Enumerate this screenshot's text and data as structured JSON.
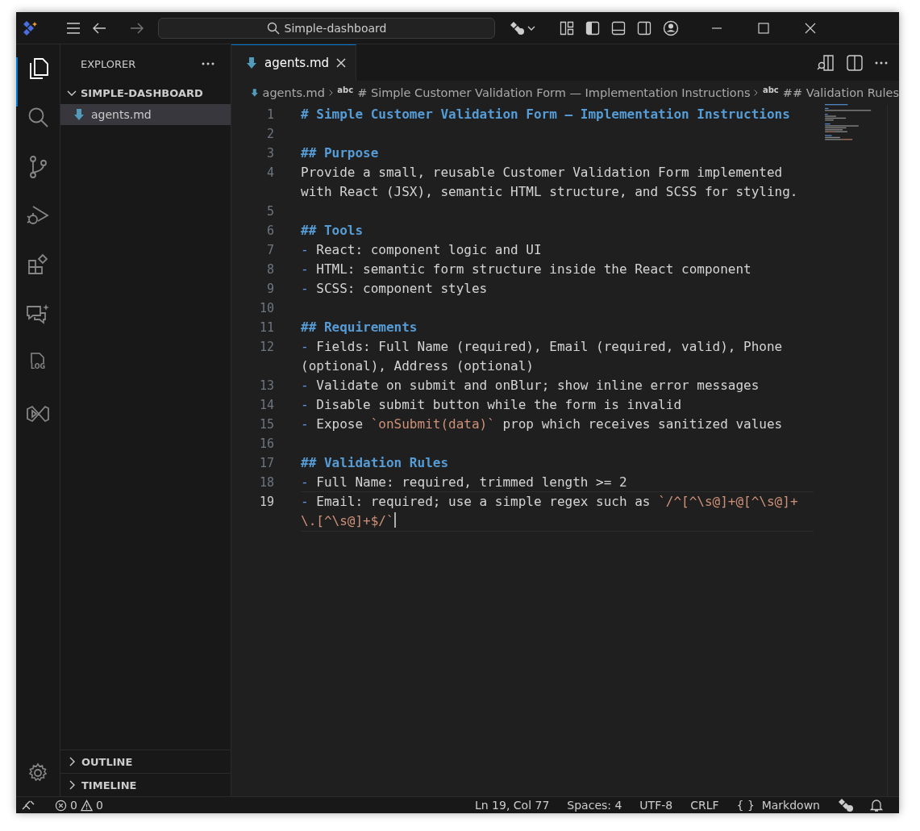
{
  "title_bar": {
    "search": {
      "value": "Simple-dashboard"
    }
  },
  "activity_bar": {
    "items": [
      {
        "kind": "files",
        "selected": true
      },
      {
        "kind": "search",
        "selected": false
      },
      {
        "kind": "source-control",
        "selected": false
      },
      {
        "kind": "run-debug",
        "selected": false
      },
      {
        "kind": "extensions",
        "selected": false
      },
      {
        "kind": "chat",
        "selected": false
      },
      {
        "kind": "log",
        "label": "LOG",
        "selected": false
      },
      {
        "kind": "studio",
        "selected": false
      }
    ]
  },
  "sidebar": {
    "title": "EXPLORER",
    "folder": {
      "label": "SIMPLE-DASHBOARD",
      "expanded": true,
      "children": [
        {
          "label": "agents.md",
          "selected": true
        }
      ]
    },
    "sections": [
      {
        "label": "OUTLINE",
        "expanded": false
      },
      {
        "label": "TIMELINE",
        "expanded": false
      }
    ]
  },
  "tabs": [
    {
      "label": "agents.md",
      "selected": true
    }
  ],
  "breadcrumbs": [
    {
      "kind": "file",
      "label": "agents.md"
    },
    {
      "kind": "symbol",
      "badge": "abc",
      "label": "# Simple Customer Validation Form — Implementation Instructions"
    },
    {
      "kind": "symbol",
      "badge": "abc",
      "label": "## Validation Rules"
    }
  ],
  "editor": {
    "lines": [
      {
        "number": "1",
        "selected": false,
        "segments": [
          {
            "kind": "heading",
            "text": "# Simple Customer Validation Form — Implementation Instructions"
          }
        ]
      },
      {
        "number": "2",
        "selected": false
      },
      {
        "number": "3",
        "selected": false,
        "segments": [
          {
            "kind": "heading",
            "text": "## Purpose"
          }
        ]
      },
      {
        "number": "4",
        "selected": false,
        "segments": [
          {
            "kind": "text",
            "text": "Provide a small, reusable Customer Validation Form implemented with React (JSX), semantic HTML structure, and SCSS for styling."
          }
        ]
      },
      {
        "number": "5",
        "selected": false
      },
      {
        "number": "6",
        "selected": false,
        "segments": [
          {
            "kind": "heading",
            "text": "## Tools"
          }
        ]
      },
      {
        "number": "7",
        "selected": false,
        "segments": [
          {
            "kind": "bullet",
            "text": "-"
          },
          {
            "kind": "text",
            "text": " React: component logic and UI"
          }
        ]
      },
      {
        "number": "8",
        "selected": false,
        "segments": [
          {
            "kind": "bullet",
            "text": "-"
          },
          {
            "kind": "text",
            "text": " HTML: semantic form structure inside the React component"
          }
        ]
      },
      {
        "number": "9",
        "selected": false,
        "segments": [
          {
            "kind": "bullet",
            "text": "-"
          },
          {
            "kind": "text",
            "text": " SCSS: component styles"
          }
        ]
      },
      {
        "number": "10",
        "selected": false
      },
      {
        "number": "11",
        "selected": false,
        "segments": [
          {
            "kind": "heading",
            "text": "## Requirements"
          }
        ]
      },
      {
        "number": "12",
        "selected": false,
        "segments": [
          {
            "kind": "bullet",
            "text": "-"
          },
          {
            "kind": "text",
            "text": " Fields: Full Name (required), Email (required, valid), Phone (optional), Address (optional)"
          }
        ]
      },
      {
        "number": "13",
        "selected": false,
        "segments": [
          {
            "kind": "bullet",
            "text": "-"
          },
          {
            "kind": "text",
            "text": " Validate on submit and onBlur; show inline error messages"
          }
        ]
      },
      {
        "number": "14",
        "selected": false,
        "segments": [
          {
            "kind": "bullet",
            "text": "-"
          },
          {
            "kind": "text",
            "text": " Disable submit button while the form is invalid"
          }
        ]
      },
      {
        "number": "15",
        "selected": false,
        "segments": [
          {
            "kind": "bullet",
            "text": "-"
          },
          {
            "kind": "text",
            "text": " Expose "
          },
          {
            "kind": "code",
            "text": "`onSubmit(data)`"
          },
          {
            "kind": "text",
            "text": " prop which receives sanitized values"
          }
        ]
      },
      {
        "number": "16",
        "selected": false
      },
      {
        "number": "17",
        "selected": false,
        "segments": [
          {
            "kind": "heading",
            "text": "## Validation Rules"
          }
        ]
      },
      {
        "number": "18",
        "selected": false,
        "segments": [
          {
            "kind": "bullet",
            "text": "-"
          },
          {
            "kind": "text",
            "text": " Full Name: required, trimmed length >= 2"
          }
        ]
      },
      {
        "number": "19",
        "selected": true,
        "segments": [
          {
            "kind": "bullet",
            "text": "-"
          },
          {
            "kind": "text",
            "text": " Email: required; use a simple regex such as "
          },
          {
            "kind": "code",
            "text": "`/^[^\\s@]+@[^\\s@]+\\.[^\\s@]+$/`"
          }
        ]
      }
    ]
  },
  "status_bar": {
    "errors": "0",
    "warnings": "0",
    "items": [
      {
        "kind": "text",
        "text": "Ln 19, Col 77"
      },
      {
        "kind": "text",
        "text": "Spaces: 4"
      },
      {
        "kind": "text",
        "text": "UTF-8"
      },
      {
        "kind": "text",
        "text": "CRLF"
      },
      {
        "kind": "language",
        "icon": "{ }",
        "text": "Markdown"
      }
    ]
  }
}
